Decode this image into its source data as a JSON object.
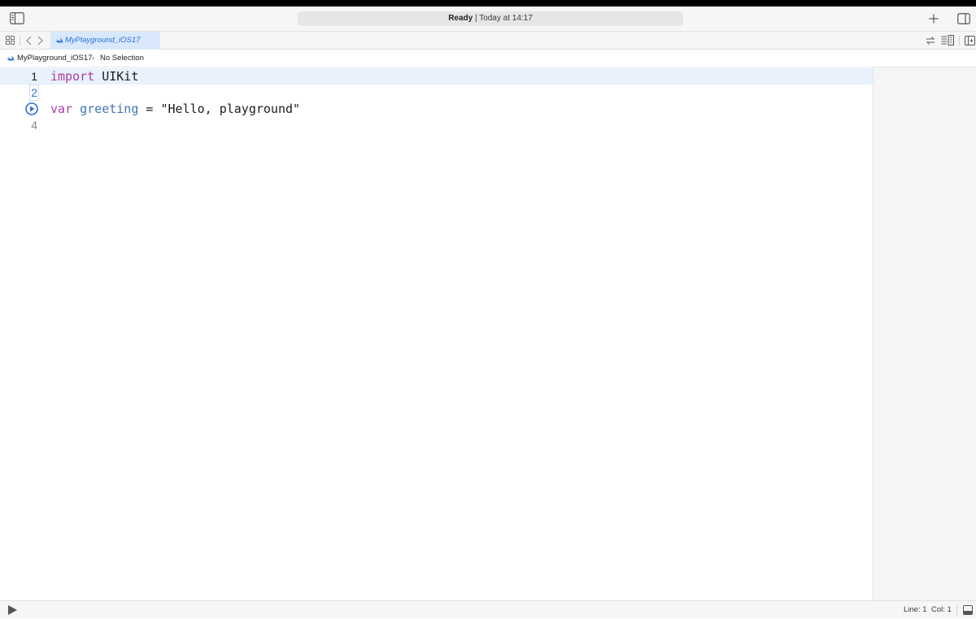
{
  "toolbar": {
    "status_bold": "Ready",
    "status_rest": " | Today at 14:17",
    "icons": [
      "sidebar-icon",
      "add-icon",
      "inspector-icon"
    ]
  },
  "tabbar": {
    "tab_label": "MyPlayground_iOS17",
    "icons": [
      "grid-icon",
      "back-icon",
      "forward-icon",
      "swap-icon",
      "editor-options-icon",
      "split-editor-icon"
    ]
  },
  "jumpbar": {
    "file": "MyPlayground_iOS17",
    "separator": "›",
    "selection": "No Selection"
  },
  "editor": {
    "lines": [
      {
        "number": "1",
        "parts": [
          {
            "text": "import",
            "style": "kw"
          },
          {
            "text": " UIKit",
            "style": "plain"
          }
        ]
      },
      {
        "number": "2",
        "parts": []
      },
      {
        "number": "",
        "parts": [
          {
            "text": "var",
            "style": "kw"
          },
          {
            "text": " greeting",
            "style": "fn"
          },
          {
            "text": " = \"Hello, playground\"",
            "style": "plain"
          }
        ]
      },
      {
        "number": "4",
        "parts": []
      }
    ],
    "line1_kw": "import",
    "line1_rest": " UIKit",
    "line3_kw": "var",
    "line3_name": " greeting",
    "line3_rest": " = \"Hello, playground\""
  },
  "bottombar": {
    "line_label": "Line: 1",
    "col_label": "Col: 1"
  },
  "colors": {
    "keyword": "#ad3da4",
    "identifier": "#3e74b6",
    "accent": "#2e6fd8",
    "active_line": "#e8f1fc"
  }
}
